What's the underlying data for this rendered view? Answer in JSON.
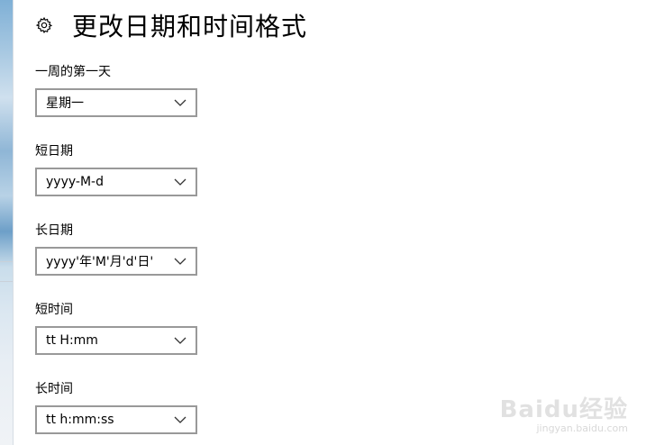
{
  "page": {
    "title": "更改日期和时间格式"
  },
  "settings": [
    {
      "label": "一周的第一天",
      "value": "星期一"
    },
    {
      "label": "短日期",
      "value": "yyyy-M-d"
    },
    {
      "label": "长日期",
      "value": "yyyy'年'M'月'd'日'"
    },
    {
      "label": "短时间",
      "value": "tt H:mm"
    },
    {
      "label": "长时间",
      "value": "tt h:mm:ss"
    }
  ],
  "watermark": {
    "main": "Baidu经验",
    "sub": "jingyan.baidu.com"
  },
  "icons": {
    "settings": "gear-icon",
    "dropdown": "chevron-down-icon"
  }
}
